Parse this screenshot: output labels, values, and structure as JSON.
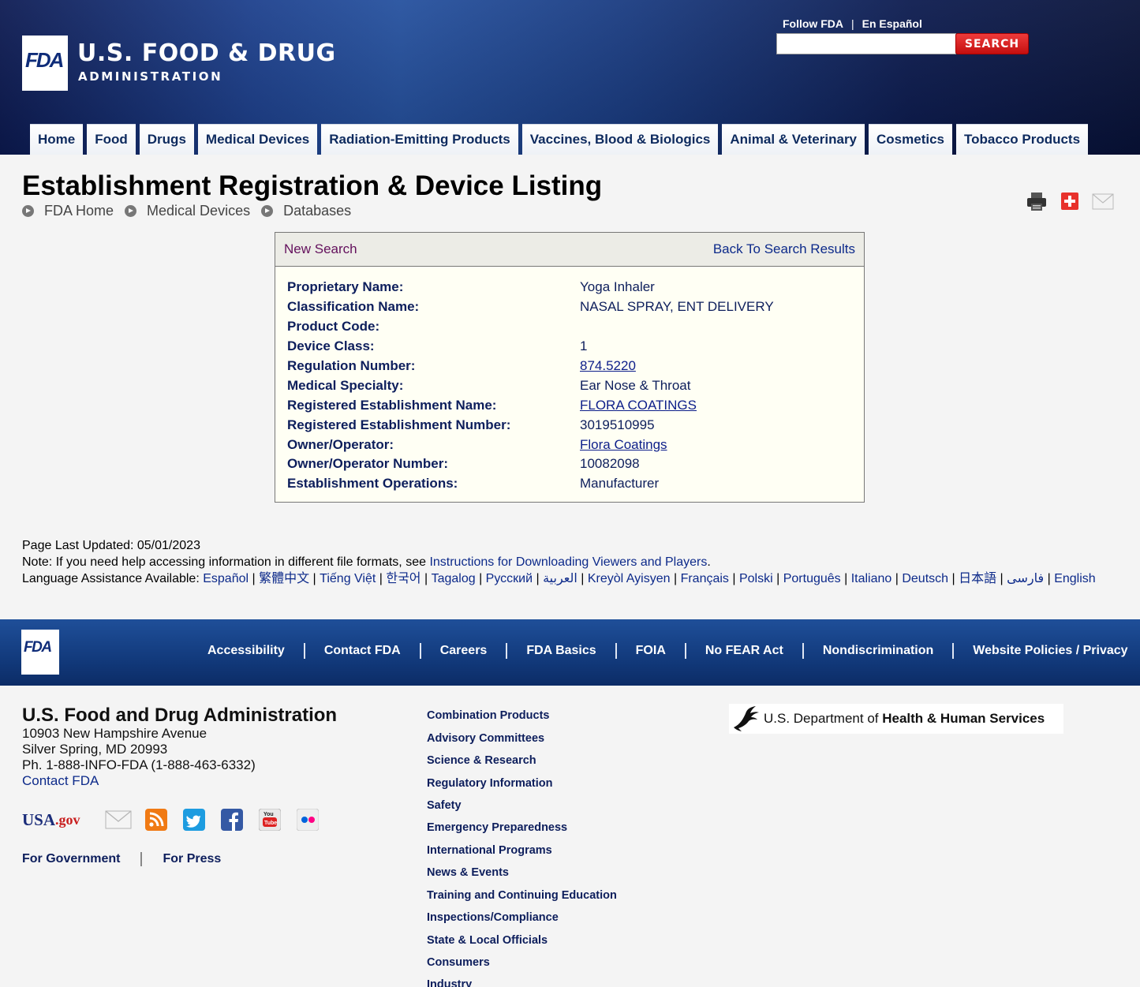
{
  "header": {
    "logo_text": "FDA",
    "agency_name": "U.S. FOOD & DRUG",
    "agency_sub": "ADMINISTRATION",
    "follow_link": "Follow FDA",
    "separator": "|",
    "spanish_link": "En Español",
    "search_placeholder": "",
    "search_button": "SEARCH"
  },
  "nav": [
    {
      "label": "Home"
    },
    {
      "label": "Food"
    },
    {
      "label": "Drugs"
    },
    {
      "label": "Medical Devices"
    },
    {
      "label": "Radiation-Emitting Products"
    },
    {
      "label": "Vaccines, Blood & Biologics"
    },
    {
      "label": "Animal & Veterinary"
    },
    {
      "label": "Cosmetics"
    },
    {
      "label": "Tobacco Products"
    }
  ],
  "page": {
    "title": "Establishment Registration & Device Listing",
    "breadcrumb": [
      "FDA Home",
      "Medical Devices",
      "Databases"
    ],
    "tools": [
      "print-icon",
      "share-plus-icon",
      "email-icon"
    ]
  },
  "result": {
    "new_search": "New Search",
    "back_to_results": "Back To Search Results",
    "rows": [
      {
        "label": "Proprietary Name:",
        "value": "Yoga Inhaler",
        "link": false
      },
      {
        "label": "Classification Name:",
        "value": "NASAL SPRAY, ENT DELIVERY",
        "link": false
      },
      {
        "label": "Product Code:",
        "value": "",
        "link": false
      },
      {
        "label": "Device Class:",
        "value": "1",
        "link": false
      },
      {
        "label": "Regulation Number:",
        "value": "874.5220",
        "link": true
      },
      {
        "label": "Medical Specialty:",
        "value": "Ear Nose & Throat",
        "link": false
      },
      {
        "label": "Registered Establishment Name:",
        "value": "FLORA COATINGS",
        "link": true
      },
      {
        "label": "Registered Establishment Number:",
        "value": "3019510995",
        "link": false
      },
      {
        "label": "Owner/Operator:",
        "value": "Flora Coatings",
        "link": true
      },
      {
        "label": "Owner/Operator Number:",
        "value": "10082098",
        "link": false
      },
      {
        "label": "Establishment Operations:",
        "value": "Manufacturer",
        "link": false
      }
    ]
  },
  "info": {
    "last_updated": "Page Last Updated: 05/01/2023",
    "note_prefix": "Note: If you need help accessing information in different file formats, see ",
    "note_link": "Instructions for Downloading Viewers and Players",
    "note_suffix": ".",
    "lang_prefix": "Language Assistance Available: ",
    "languages": [
      "Español",
      "繁體中文",
      "Tiếng Việt",
      "한국어",
      "Tagalog",
      "Русский",
      "العربية",
      "Kreyòl Ayisyen",
      "Français",
      "Polski",
      "Português",
      "Italiano",
      "Deutsch",
      "日本語",
      "فارسی",
      "English"
    ]
  },
  "footer_nav": {
    "logo_text": "FDA",
    "links": [
      "Accessibility",
      "Contact FDA",
      "Careers",
      "FDA Basics",
      "FOIA",
      "No FEAR Act",
      "Nondiscrimination",
      "Website Policies / Privacy"
    ]
  },
  "org": {
    "name": "U.S. Food and Drug Administration",
    "address1": "10903 New Hampshire Avenue",
    "address2": "Silver Spring, MD 20993",
    "phone": "Ph. 1-888-INFO-FDA (1-888-463-6332)",
    "contact": "Contact FDA",
    "usagov_text": "USA",
    "usagov_suffix": ".gov",
    "social": [
      "email-icon",
      "rss-icon",
      "twitter-icon",
      "facebook-icon",
      "youtube-icon",
      "flickr-icon"
    ],
    "for_government": "For Government",
    "for_press": "For Press"
  },
  "footer_links": [
    "Combination Products",
    "Advisory Committees",
    "Science & Research",
    "Regulatory Information",
    "Safety",
    "Emergency Preparedness",
    "International Programs",
    "News & Events",
    "Training and Continuing Education",
    "Inspections/Compliance",
    "State & Local Officials",
    "Consumers",
    "Industry"
  ],
  "hhs": {
    "prefix": "U.S. Department of ",
    "bold": "Health & Human Services"
  },
  "colors": {
    "header_blue": "#1c3f8c",
    "search_red": "#d41f1f",
    "panel_bg": "#fffff4",
    "link_blue": "#0d2a8a",
    "new_search_purple": "#63105c"
  }
}
